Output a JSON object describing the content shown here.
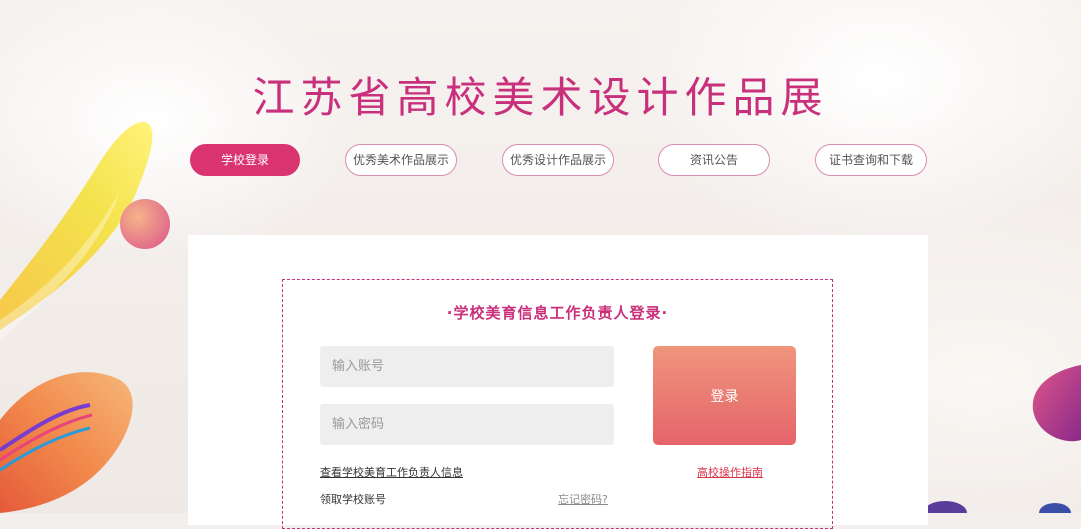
{
  "page_title": "江苏省高校美术设计作品展",
  "nav": {
    "items": [
      {
        "label": "学校登录",
        "active": true
      },
      {
        "label": "优秀美术作品展示",
        "active": false
      },
      {
        "label": "优秀设计作品展示",
        "active": false
      },
      {
        "label": "资讯公告",
        "active": false
      },
      {
        "label": "证书查询和下载",
        "active": false
      }
    ]
  },
  "login": {
    "heading": "·学校美育信息工作负责人登录·",
    "account_placeholder": "输入账号",
    "account_value": "",
    "password_placeholder": "输入密码",
    "password_value": "",
    "submit_label": "登录",
    "view_info_link": "查看学校美育工作负责人信息",
    "guide_link": "高校操作指南",
    "get_account_text": "领取学校账号",
    "forgot_password_link": "忘记密码?"
  },
  "colors": {
    "accent": "#c9307c",
    "active_nav": "#d9346f",
    "button_top": "#f0957d",
    "button_bottom": "#e5646a"
  }
}
